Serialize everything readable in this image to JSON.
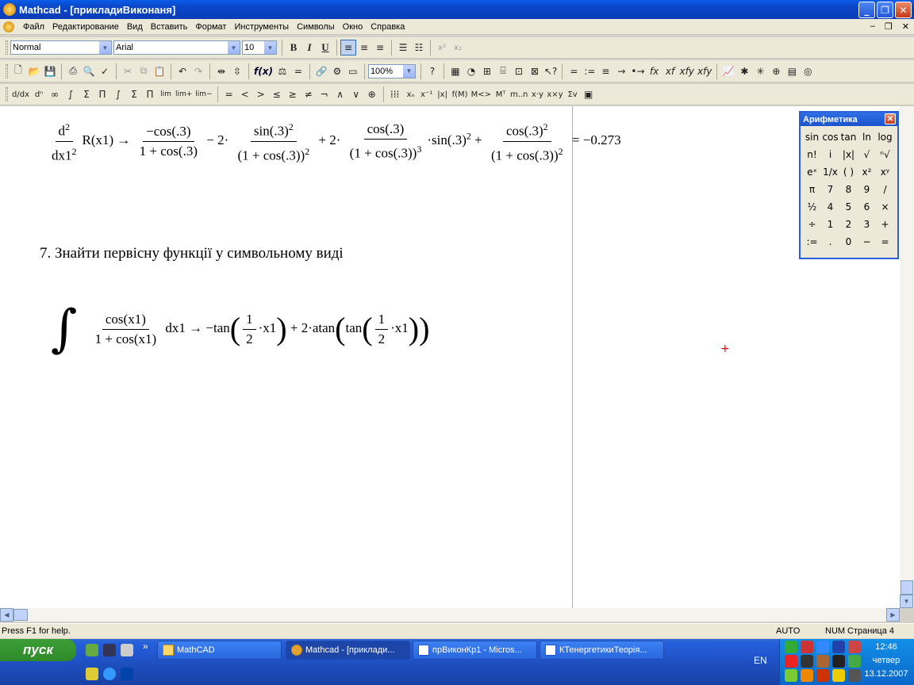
{
  "window": {
    "title": "Mathcad - [прикладиВиконаня]"
  },
  "menu": [
    "Файл",
    "Редактирование",
    "Вид",
    "Вставить",
    "Формат",
    "Инструменты",
    "Символы",
    "Окно",
    "Справка"
  ],
  "format_bar": {
    "style": "Normal",
    "font": "Arial",
    "size": "10",
    "bold": "B",
    "italic": "I",
    "underline": "U"
  },
  "standard_bar": {
    "zoom": "100%"
  },
  "math_bar_labels": [
    "=",
    ":=",
    "≡",
    "→",
    "•→",
    "fx",
    "xf",
    "xfy",
    "xfy"
  ],
  "operators": [
    "=",
    "<",
    ">",
    "≤",
    "≥",
    "≠",
    "¬",
    "∧",
    "∨",
    "⊕"
  ],
  "document": {
    "derivative": {
      "d2": "d",
      "sq": "2",
      "dx": "dx1",
      "sq2": "2",
      "fn": "R(x1) →",
      "t1_num": "−cos(.3)",
      "t1_den": "1 + cos(.3)",
      "op2": "− 2·",
      "t2_num": "sin(.3)",
      "t2_num_exp": "2",
      "t2_den": "(1 + cos(.3))",
      "t2_den_exp": "2",
      "op3": "+ 2·",
      "t3_num": "cos(.3)",
      "t3_den": "(1 + cos(.3))",
      "t3_den_exp": "3",
      "t3_tail": "·sin(.3)",
      "t3_tail_exp": "2",
      "op4": "+",
      "t4_num": "cos(.3)",
      "t4_num_exp": "2",
      "t4_den": "(1 + cos(.3))",
      "t4_den_exp": "2",
      "result": "= −0.273"
    },
    "heading": "7. Знайти первісну функції у символьному виді",
    "integral": {
      "sign": "∫",
      "num": "cos(x1)",
      "den": "1 + cos(x1)",
      "dx": "dx1 →",
      "r1": "−tan",
      "half_num": "1",
      "half_den": "2",
      "x": "·x1",
      "r2": "+ 2·atan",
      "tan": "tan"
    }
  },
  "palette": {
    "title": "Арифметика",
    "keys": [
      "sin",
      "cos",
      "tan",
      "ln",
      "log",
      "n!",
      "i",
      "|x|",
      "√",
      "ⁿ√",
      "eˣ",
      "1/x",
      "( )",
      "x²",
      "xʸ",
      "π",
      "7",
      "8",
      "9",
      "/",
      "½",
      "4",
      "5",
      "6",
      "×",
      "÷",
      "1",
      "2",
      "3",
      "+",
      ":=",
      ".",
      "0",
      "−",
      "="
    ]
  },
  "status": {
    "help": "Press F1 for help.",
    "auto": "AUTO",
    "num": "NUM",
    "page": "Страница 4"
  },
  "taskbar": {
    "start": "пуск",
    "buttons": [
      "MathCAD",
      "Mathcad - [приклади...",
      "прВиконКр1 - Micros...",
      "КТенергетикиТеорія..."
    ],
    "lang": "EN",
    "time": "12:46",
    "day": "четвер",
    "date": "13.12.2007"
  }
}
